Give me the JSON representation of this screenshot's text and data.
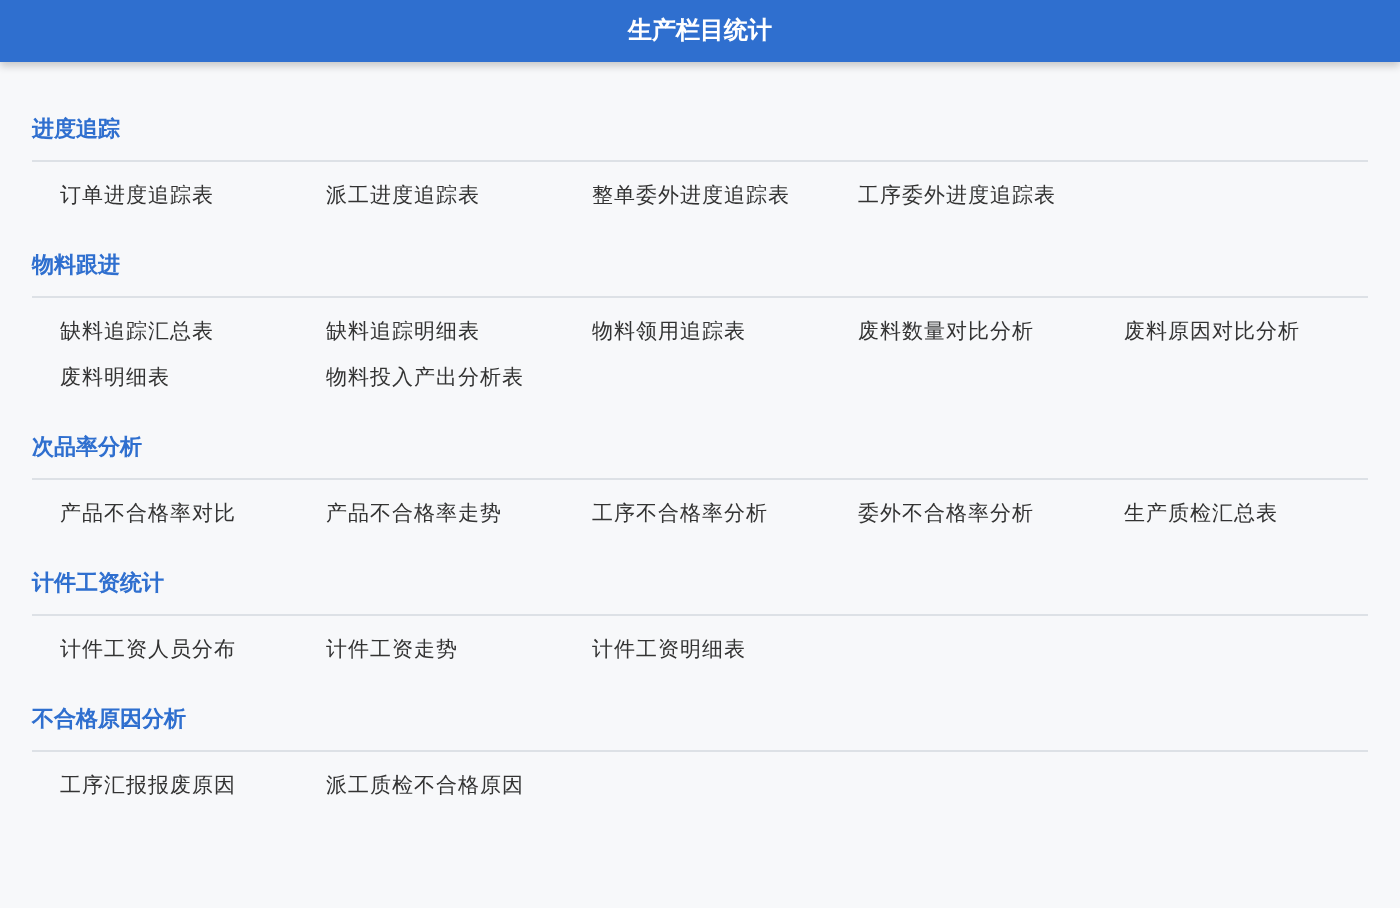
{
  "header": {
    "title": "生产栏目统计"
  },
  "sections": [
    {
      "title": "进度追踪",
      "items": [
        "订单进度追踪表",
        "派工进度追踪表",
        "整单委外进度追踪表",
        "工序委外进度追踪表"
      ]
    },
    {
      "title": "物料跟进",
      "items": [
        "缺料追踪汇总表",
        "缺料追踪明细表",
        "物料领用追踪表",
        "废料数量对比分析",
        "废料原因对比分析",
        "废料明细表",
        "物料投入产出分析表"
      ]
    },
    {
      "title": "次品率分析",
      "items": [
        "产品不合格率对比",
        "产品不合格率走势",
        "工序不合格率分析",
        "委外不合格率分析",
        "生产质检汇总表"
      ]
    },
    {
      "title": "计件工资统计",
      "items": [
        "计件工资人员分布",
        "计件工资走势",
        "计件工资明细表"
      ]
    },
    {
      "title": "不合格原因分析",
      "items": [
        "工序汇报报废原因",
        "派工质检不合格原因"
      ]
    }
  ]
}
